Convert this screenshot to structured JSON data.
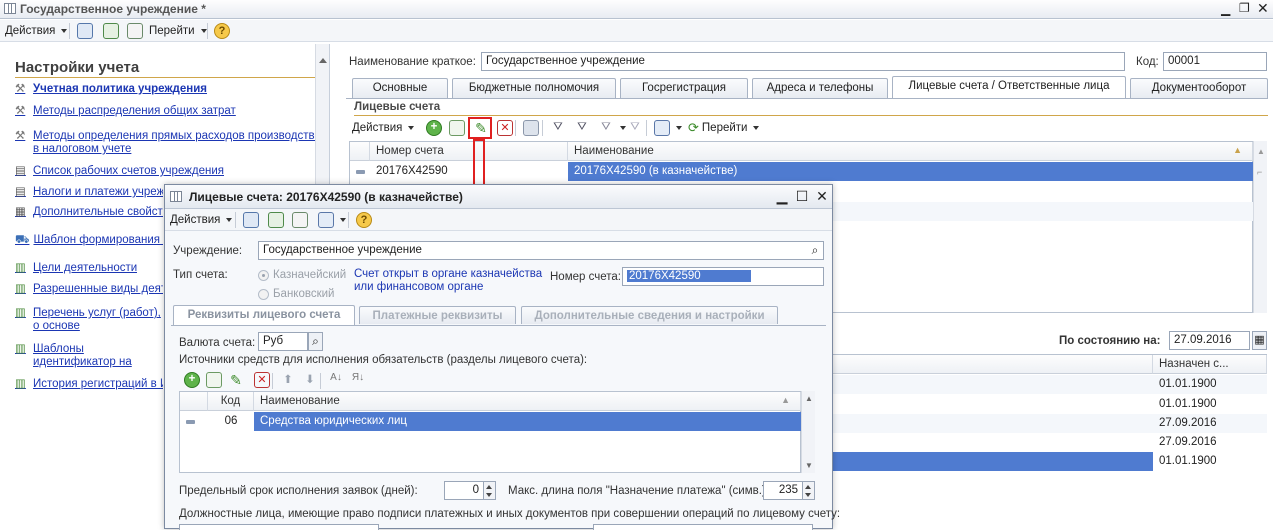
{
  "window": {
    "title": "Государственное учреждение *"
  },
  "toolbar": {
    "actions_label": "Действия",
    "goto_label": "Перейти"
  },
  "left_panel": {
    "title": "Настройки учета",
    "items": [
      {
        "label": "Учетная политика учреждения",
        "bold": true
      },
      {
        "label": "Методы распределения общих затрат"
      },
      {
        "label": "Методы определения прямых расходов производства в налоговом учете"
      },
      {
        "label": "Список рабочих счетов учреждения"
      },
      {
        "label": "Налоги и платежи учрежд"
      },
      {
        "label": "Дополнительные свойств"
      },
      {
        "label": "Шаблон формирования и"
      },
      {
        "label": "Цели деятельности"
      },
      {
        "label": "Разрешенные виды деяте"
      },
      {
        "label": "Перечень услуг (работ), о основе"
      },
      {
        "label": "Шаблоны идентификатор на оплату гос. услуг"
      },
      {
        "label": "История регистраций в И"
      }
    ]
  },
  "main": {
    "short_name_label": "Наименование краткое:",
    "short_name_value": "Государственное учреждение",
    "code_label": "Код:",
    "code_value": "00001",
    "tabs": [
      "Основные",
      "Бюджетные полномочия",
      "Госрегистрация",
      "Адреса и телефоны",
      "Лицевые счета / Ответственные лица",
      "Документооборот"
    ],
    "section_title": "Лицевые счета",
    "section_actions": "Действия",
    "section_goto": "Перейти",
    "grid": {
      "headers": [
        "Номер счета",
        "Наименование"
      ],
      "rows": [
        {
          "num": "20176X42590",
          "name": "20176X42590 (в казначействе)"
        }
      ]
    },
    "as_of_label": "По состоянию на:",
    "as_of_date": "27.09.2016",
    "assigned_header": "Назначен с...",
    "assigned_rows": [
      "01.01.1900",
      "01.01.1900",
      "27.09.2016",
      "27.09.2016",
      "01.01.1900"
    ]
  },
  "dialog": {
    "title": "Лицевые счета: 20176X42590 (в казначействе)",
    "actions_label": "Действия",
    "institution_label": "Учреждение:",
    "institution_value": "Государственное учреждение",
    "account_type_label": "Тип счета:",
    "radio_treasury": "Казначейский",
    "radio_bank": "Банковский",
    "note": "Счет открыт в органе казначейства или финансовом органе",
    "account_number_label": "Номер счета:",
    "account_number_value": "20176X42590",
    "tabs": [
      "Реквизиты лицевого счета",
      "Платежные реквизиты",
      "Дополнительные сведения и настройки"
    ],
    "currency_label": "Валюта счета:",
    "currency_value": "Руб",
    "sources_label": "Источники средств для исполнения обязательств (разделы лицевого счета):",
    "grid_headers": [
      "Код",
      "Наименование"
    ],
    "grid_rows": [
      {
        "code": "06",
        "name": "Средства юридических лиц"
      }
    ],
    "deadline_label": "Предельный срок исполнения заявок (дней):",
    "deadline_value": "0",
    "maxlen_label": "Макс. длина поля \"Назначение платежа\" (симв.):",
    "maxlen_value": "235",
    "officials_label": "Должностные лица, имеющие право подписи платежных и иных документов при совершении операций по лицевому счету:"
  }
}
